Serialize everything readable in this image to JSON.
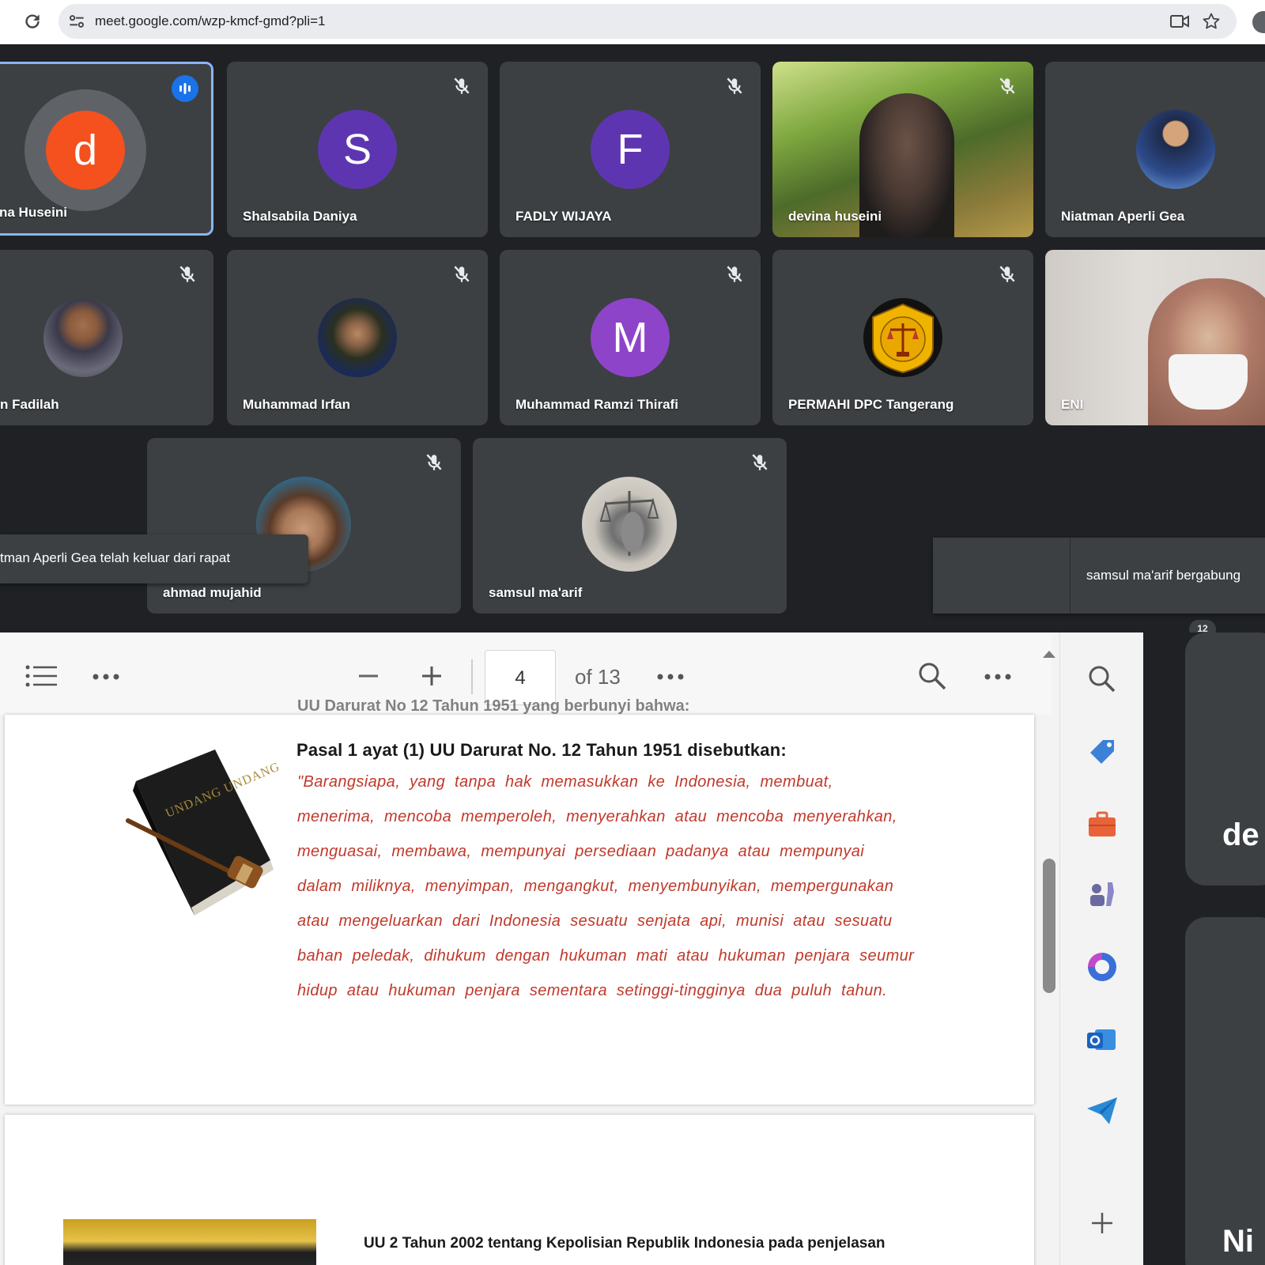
{
  "browser": {
    "url": "meet.google.com/wzp-kmcf-gmd?pli=1",
    "icons": [
      "reload-icon",
      "site-info-icon",
      "camera-icon",
      "star-icon"
    ]
  },
  "meet": {
    "participants": [
      {
        "name": "na Huseini",
        "initial": "d",
        "color": "#f4511e",
        "speaking": true
      },
      {
        "name": "Shalsabila Daniya",
        "initial": "S",
        "color": "#5e35b1",
        "muted": true
      },
      {
        "name": "FADLY WIJAYA",
        "initial": "F",
        "color": "#5e35b1",
        "muted": true
      },
      {
        "name": "devina huseini",
        "video": true,
        "muted": true
      },
      {
        "name": "Niatman Aperli Gea",
        "photo": true
      },
      {
        "name": "n Fadilah",
        "photo": true,
        "muted": true
      },
      {
        "name": "Muhammad Irfan",
        "photo": true,
        "muted": true
      },
      {
        "name": "Muhammad Ramzi Thirafi",
        "initial": "M",
        "color": "#8e44c9",
        "muted": true
      },
      {
        "name": "PERMAHI DPC Tangerang",
        "photo": true,
        "muted": true
      },
      {
        "name": "ENI",
        "video": true
      },
      {
        "name": "ahmad mujahid",
        "photo": true,
        "muted": true
      },
      {
        "name": "samsul ma'arif",
        "photo": true,
        "muted": true
      }
    ],
    "toast_left": "tman Aperli Gea telah keluar dari rapat",
    "toast_right": "samsul ma'arif bergabung",
    "badge_count": "12"
  },
  "pdf": {
    "current_page": "4",
    "page_total": "of 13",
    "top_cut_text": "UU Darurat No 12 Tahun 1951 yang berbunyi bahwa:",
    "heading": "Pasal 1 ayat (1) UU Darurat No. 12 Tahun 1951 disebutkan:",
    "quote_lines": [
      "\"Barangsiapa, yang tanpa hak memasukkan ke Indonesia, membuat,",
      "menerima, mencoba memperoleh, menyerahkan atau mencoba menyerahkan,",
      "menguasai, membawa, mempunyai persediaan padanya atau mempunyai",
      "dalam miliknya, menyimpan, mengangkut, menyembunyikan, mempergunakan",
      "atau mengeluarkan dari Indonesia sesuatu senjata api, munisi atau sesuatu",
      "bahan peledak, dihukum dengan hukuman mati atau hukuman penjara seumur",
      "hidup atau hukuman penjara sementara setinggi-tingginya dua puluh tahun."
    ],
    "book_label": "UNDANG UNDANG",
    "next_heading": "UU 2 Tahun 2002 tentang Kepolisian Republik Indonesia pada penjelasan",
    "quote_color": "#c0392b"
  },
  "right_strip": {
    "text_1": "de",
    "text_2": "Ni"
  }
}
